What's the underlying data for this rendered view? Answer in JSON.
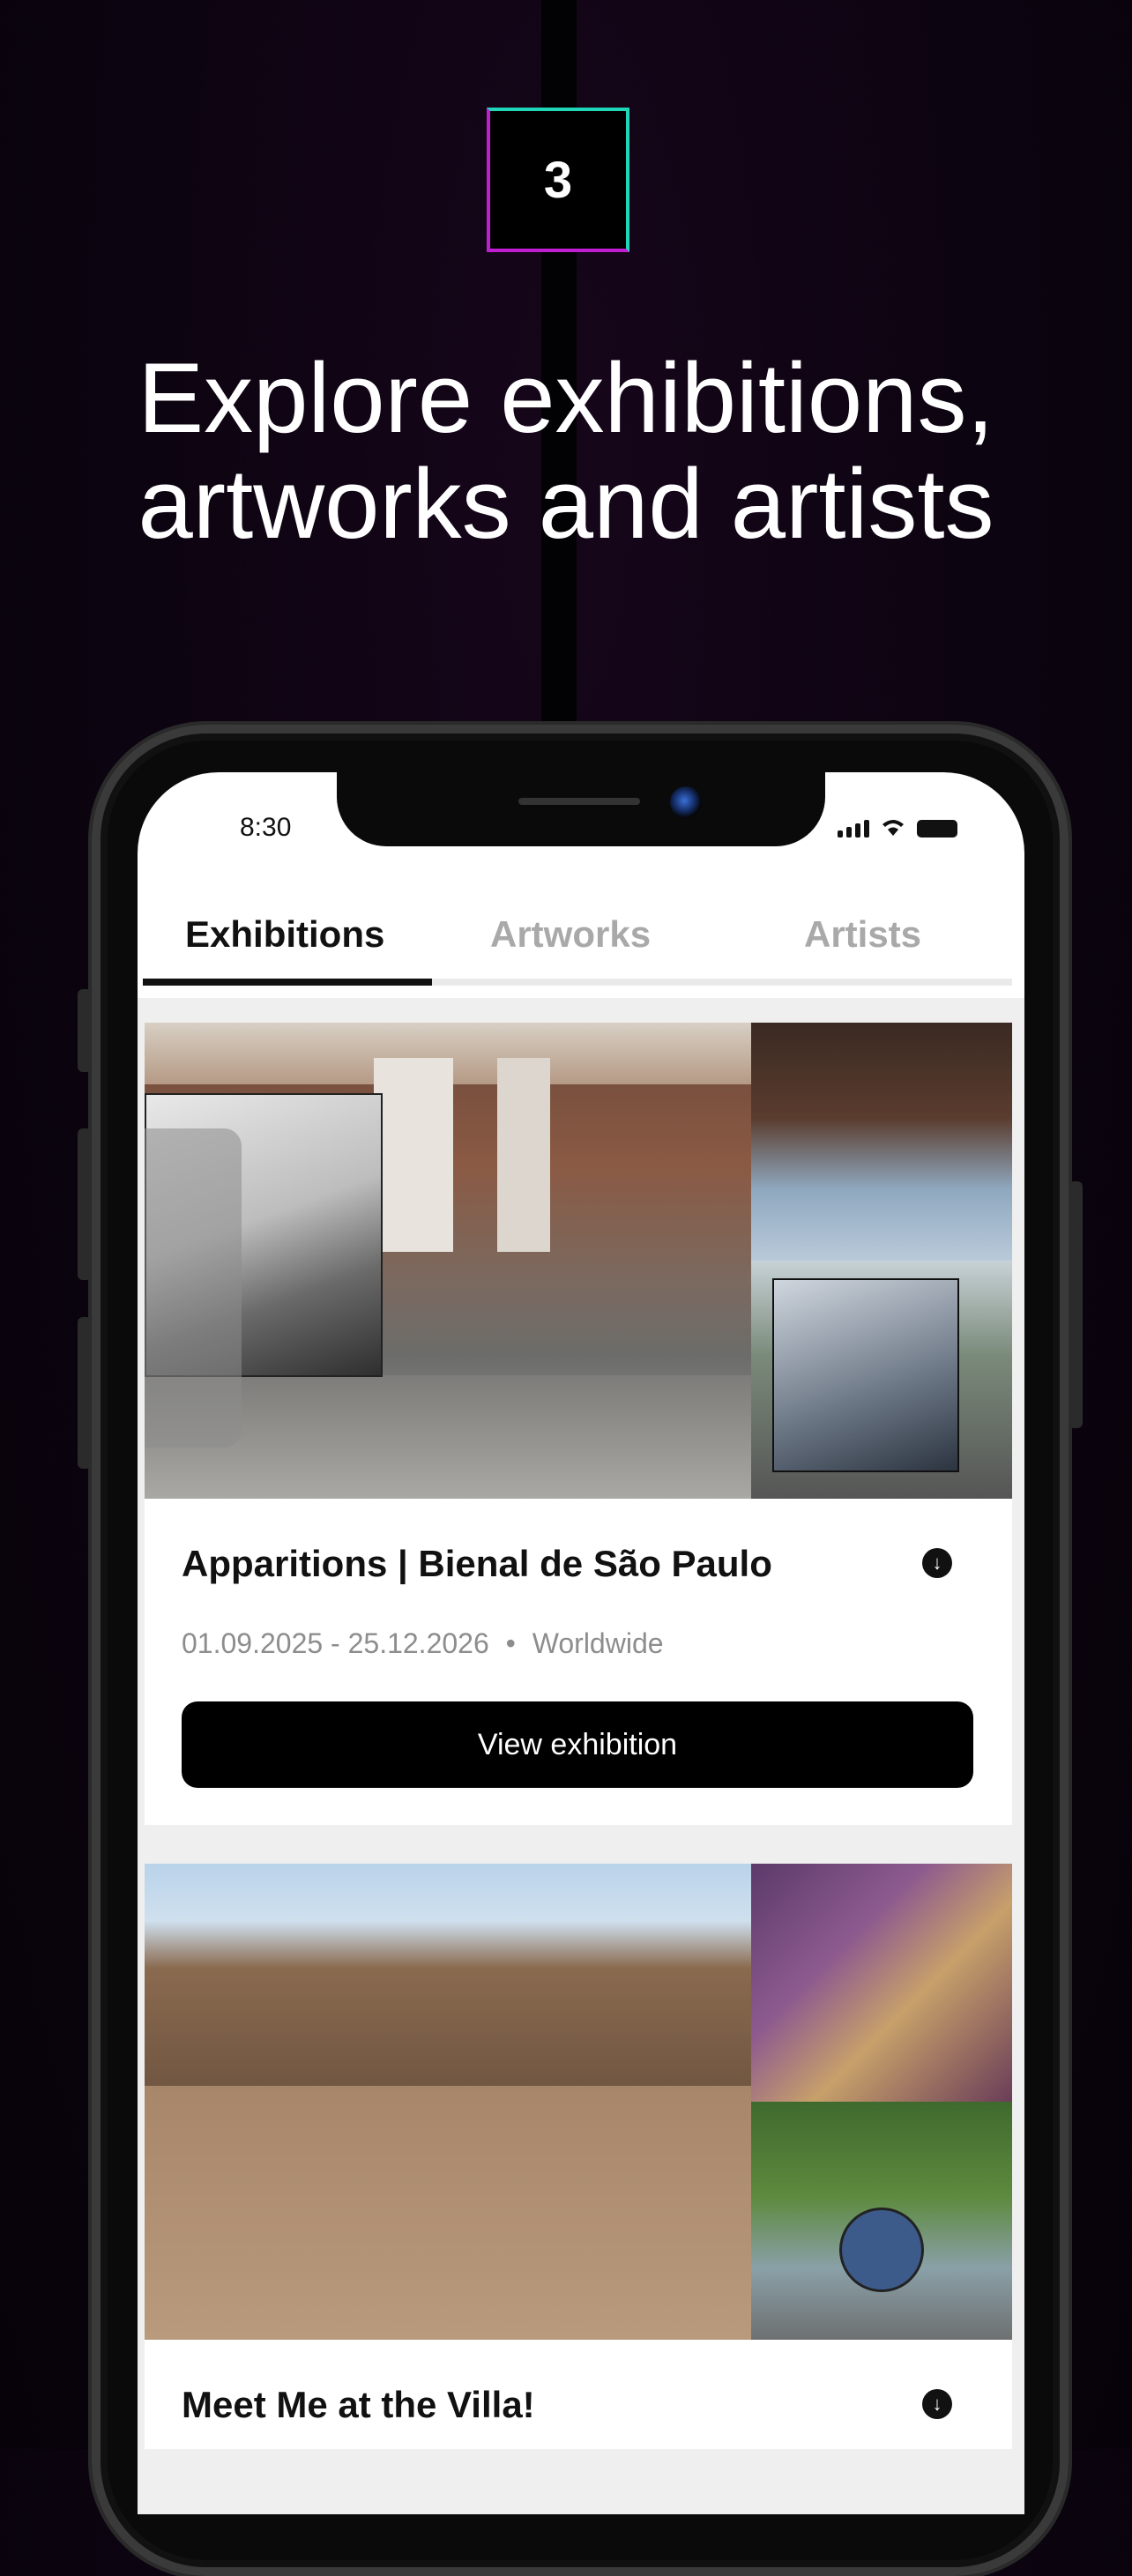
{
  "promo": {
    "step_number": "3",
    "headline_line1": "Explore exhibitions,",
    "headline_line2": "artworks and artists"
  },
  "status_bar": {
    "time": "8:30",
    "icons": [
      "signal-icon",
      "wifi-icon",
      "battery-icon"
    ]
  },
  "tabs": [
    {
      "label": "Exhibitions",
      "active": true
    },
    {
      "label": "Artworks",
      "active": false
    },
    {
      "label": "Artists",
      "active": false
    }
  ],
  "exhibitions": [
    {
      "title": "Apparitions | Bienal de São Paulo",
      "dates": "01.09.2025 - 25.12.2026",
      "location": "Worldwide",
      "button_label": "View exhibition",
      "download_icon": "download-icon"
    },
    {
      "title": "Meet Me at the Villa!",
      "download_icon": "download-icon"
    }
  ],
  "colors": {
    "accent_magenta": "#c11ed3",
    "accent_teal": "#1fd6b8",
    "tab_active": "#111111",
    "tab_inactive": "#a9a9a9"
  }
}
